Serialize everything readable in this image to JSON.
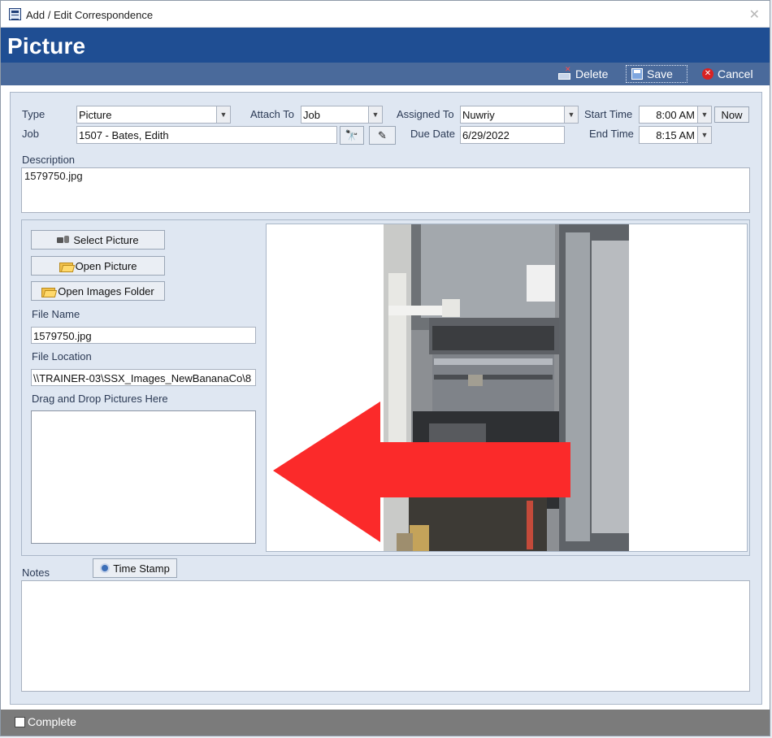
{
  "window": {
    "title": "Add / Edit Correspondence"
  },
  "header": {
    "title": "Picture"
  },
  "toolbar": {
    "delete_label": "Delete",
    "save_label": "Save",
    "cancel_label": "Cancel"
  },
  "form": {
    "type_label": "Type",
    "type_value": "Picture",
    "attach_label": "Attach To",
    "attach_value": "Job",
    "assigned_label": "Assigned To",
    "assigned_value": "Nuwriy",
    "start_label": "Start Time",
    "start_value": "8:00 AM",
    "now_label": "Now",
    "job_label": "Job",
    "job_value": "1507 - Bates, Edith",
    "due_label": "Due Date",
    "due_value": "6/29/2022",
    "end_label": "End Time",
    "end_value": "8:15 AM",
    "description_label": "Description",
    "description_value": "1579750.jpg"
  },
  "picture": {
    "select_label": "Select Picture",
    "open_label": "Open Picture",
    "folder_label": "Open Images Folder",
    "filename_label": "File Name",
    "filename_value": "1579750.jpg",
    "location_label": "File Location",
    "location_value": "\\\\TRAINER-03\\SSX_Images_NewBananaCo\\8",
    "drop_label": "Drag and Drop Pictures Here"
  },
  "notes": {
    "label": "Notes",
    "timestamp_label": "Time Stamp"
  },
  "footer": {
    "complete_label": "Complete"
  },
  "colors": {
    "header": "#1f4e93",
    "toolbar": "#4a6a9b",
    "panel": "#dfe7f2",
    "arrow": "#fb2a2a",
    "footer": "#7b7b7b"
  }
}
